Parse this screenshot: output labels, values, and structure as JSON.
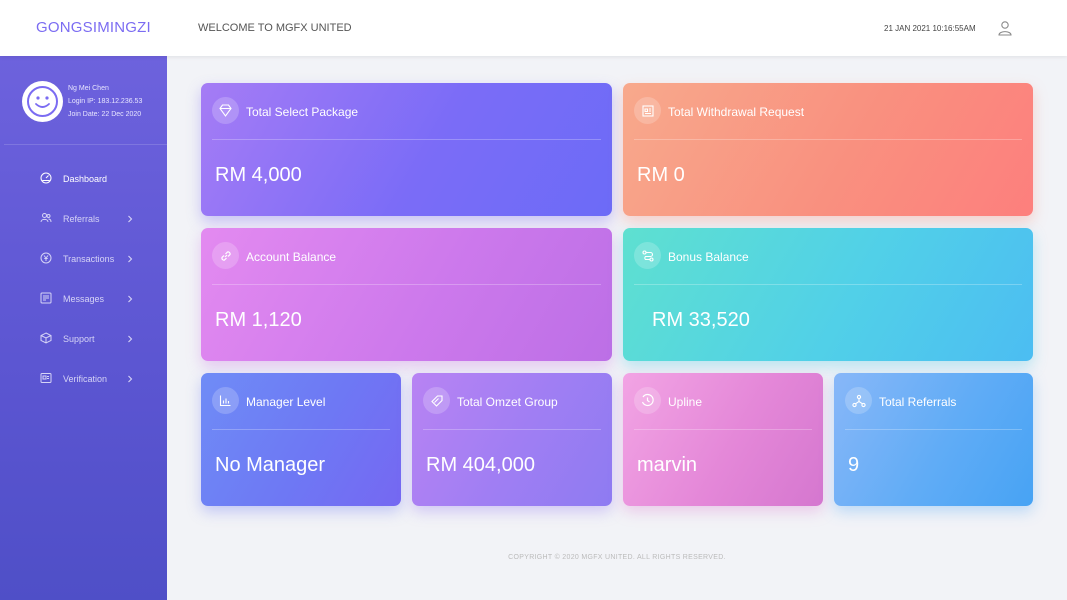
{
  "header": {
    "brand": "GONGSIMINGZI",
    "welcome": "WELCOME TO MGFX UNITED",
    "datetime": "21 JAN 2021 10:16:55AM",
    "user_icon": "user-icon"
  },
  "profile": {
    "name": "Ng Mei Chen",
    "login_ip": "Login IP: 183.12.236.53",
    "join_date": "Join Date: 22 Dec 2020",
    "avatar_icon": "smiley-icon"
  },
  "sidebar": {
    "items": [
      {
        "label": "Dashboard",
        "icon": "speedometer-icon",
        "active": true,
        "has_chevron": false
      },
      {
        "label": "Referrals",
        "icon": "users-icon",
        "has_chevron": true
      },
      {
        "label": "Transactions",
        "icon": "currency-icon",
        "has_chevron": true
      },
      {
        "label": "Messages",
        "icon": "message-icon",
        "has_chevron": true
      },
      {
        "label": "Support",
        "icon": "box-icon",
        "has_chevron": true
      },
      {
        "label": "Verification",
        "icon": "id-card-icon",
        "has_chevron": true
      }
    ]
  },
  "cards": [
    {
      "title": "Total Select Package",
      "value": "RM 4,000",
      "icon": "diamond-icon"
    },
    {
      "title": "Total Withdrawal Request",
      "value": "RM 0",
      "icon": "document-icon"
    },
    {
      "title": "Account Balance",
      "value": "RM 1,120",
      "icon": "link-icon"
    },
    {
      "title": "Bonus Balance",
      "value": "RM 33,520",
      "icon": "route-icon"
    },
    {
      "title": "Manager Level",
      "value": "No Manager",
      "icon": "bar-chart-icon"
    },
    {
      "title": "Total Omzet Group",
      "value": "RM 404,000",
      "icon": "tag-icon"
    },
    {
      "title": "Upline",
      "value": "marvin",
      "icon": "clock-icon"
    },
    {
      "title": "Total Referrals",
      "value": "9",
      "icon": "network-icon"
    }
  ],
  "footer": {
    "copyright": "COPYRIGHT © 2020 MGFX UNITED. ALL RIGHTS RESERVED."
  },
  "colors": {
    "brand": "#7b6cf2",
    "sidebar_top": "#6d62dd",
    "sidebar_bottom": "#4f4fc7",
    "background": "#f2f3f7"
  }
}
